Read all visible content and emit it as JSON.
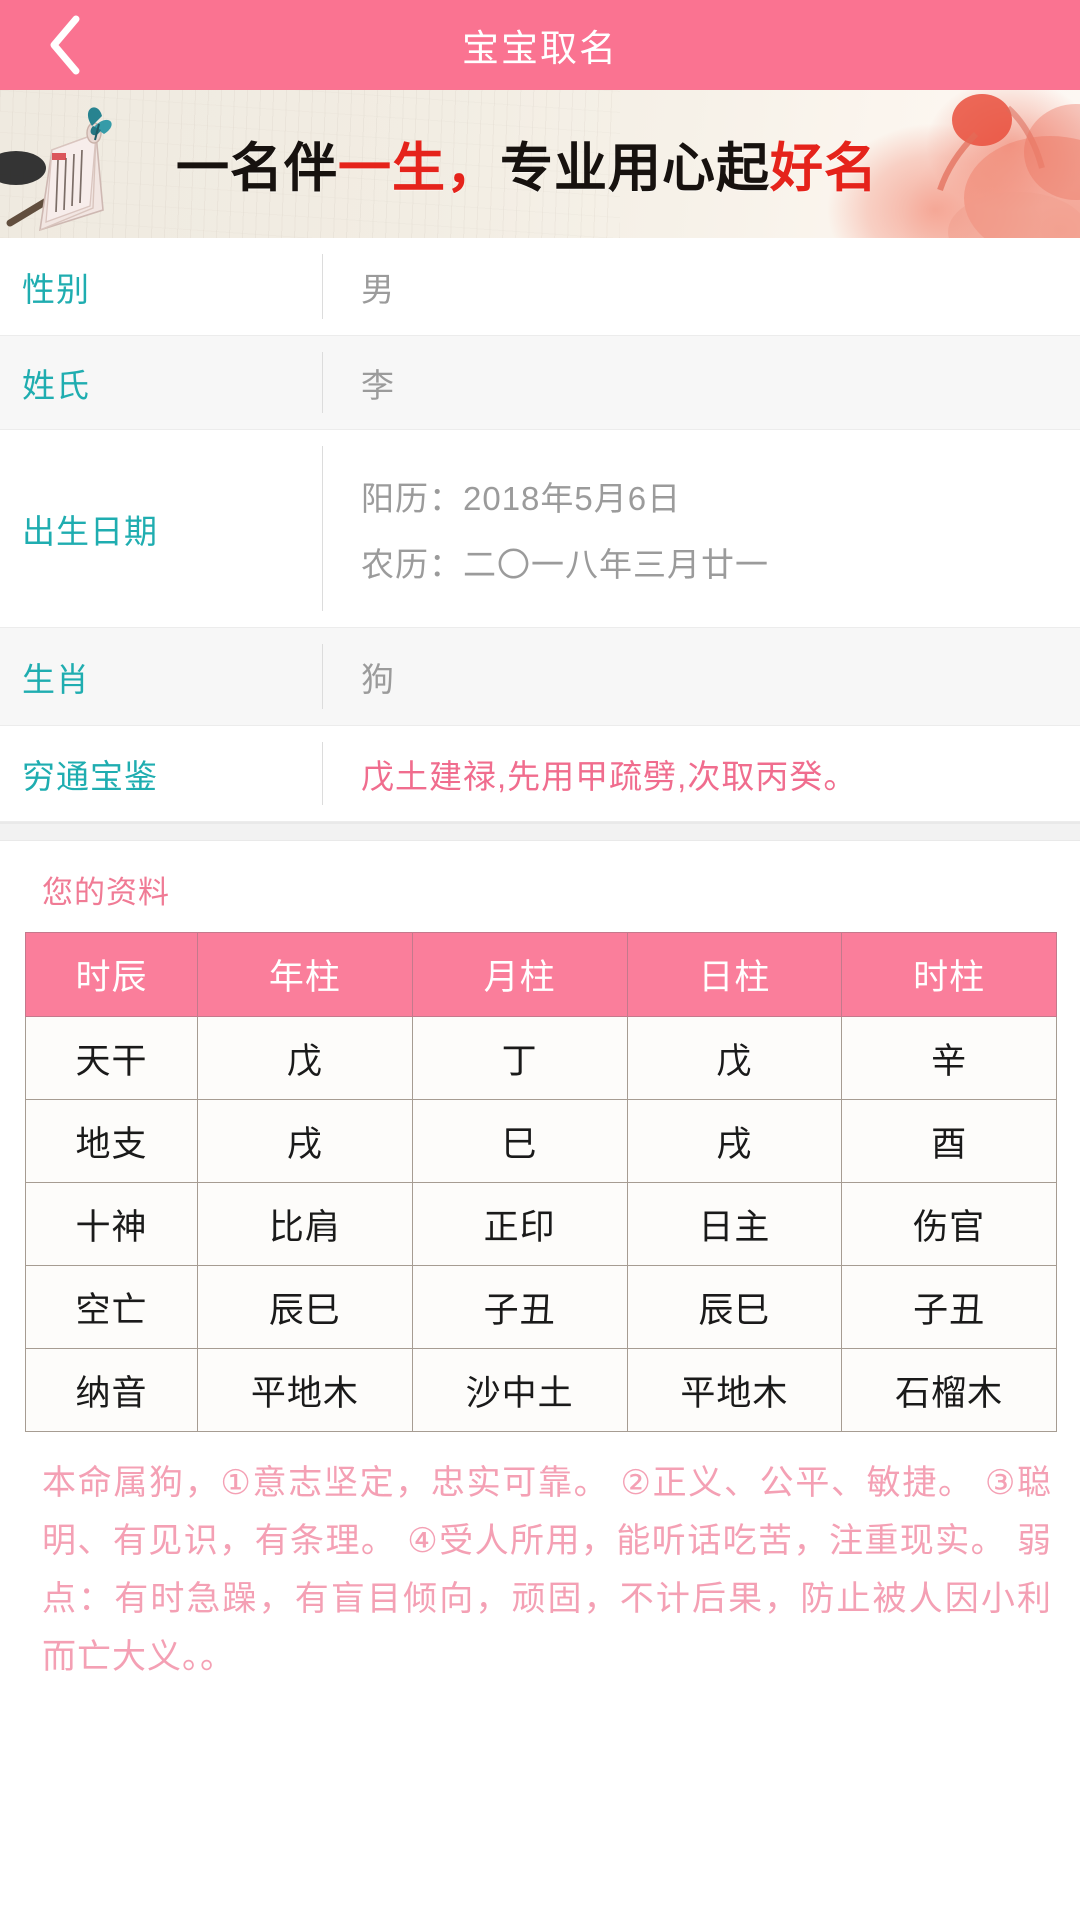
{
  "header": {
    "title": "宝宝取名",
    "back_icon": "chevron-left-icon",
    "bg_color": "#FA7391",
    "title_color": "#FFFFFF"
  },
  "banner": {
    "text_part1": "一名伴",
    "text_highlight1": "一生",
    "text_comma": "，",
    "text_part2": "专业用心起",
    "text_highlight2": "好名",
    "highlight_color": "#E5231B",
    "base_color": "#17120F",
    "art_icons": [
      "scroll-book-icon",
      "butterfly-icon",
      "ink-brush-icon",
      "red-blossom-icon"
    ]
  },
  "info_rows": [
    {
      "label": "性别",
      "value": "男"
    },
    {
      "label": "姓氏",
      "value": "李"
    },
    {
      "label": "出生日期",
      "value_line1": "阳历：2018年5月6日",
      "value_line2": "农历：二〇一八年三月廿一"
    },
    {
      "label": "生肖",
      "value": "狗"
    },
    {
      "label": "穷通宝鉴",
      "value": "戊土建禄,先用甲疏劈,次取丙癸。"
    }
  ],
  "label_color": "#1FADB0",
  "value_color": "#9B9B9B",
  "accent_pink": "#F06D8E",
  "panel": {
    "title": "您的资料",
    "title_color": "#F07B95"
  },
  "chart_data": {
    "type": "table",
    "title": "您的资料",
    "columns": [
      "时辰",
      "年柱",
      "月柱",
      "日柱",
      "时柱"
    ],
    "rows": [
      {
        "label": "天干",
        "values": [
          "戊",
          "丁",
          "戊",
          "辛"
        ]
      },
      {
        "label": "地支",
        "values": [
          "戌",
          "巳",
          "戌",
          "酉"
        ]
      },
      {
        "label": "十神",
        "values": [
          "比肩",
          "正印",
          "日主",
          "伤官"
        ]
      },
      {
        "label": "空亡",
        "values": [
          "辰巳",
          "子丑",
          "辰巳",
          "子丑"
        ]
      },
      {
        "label": "纳音",
        "values": [
          "平地木",
          "沙中土",
          "平地木",
          "石榴木"
        ]
      }
    ],
    "header_bg": "#FA7E9B",
    "header_text_color": "#FFFFFF",
    "border_color": "#A69C92"
  },
  "description": {
    "text": "本命属狗，①意志坚定，忠实可靠。 ②正义、公平、敏捷。 ③聪明、有见识，有条理。 ④受人所用，能听话吃苦，注重现实。 弱点：有时急躁，有盲目倾向，顽固，不计后果，防止被人因小利而亡大义。。",
    "color": "#F4A0B4"
  }
}
